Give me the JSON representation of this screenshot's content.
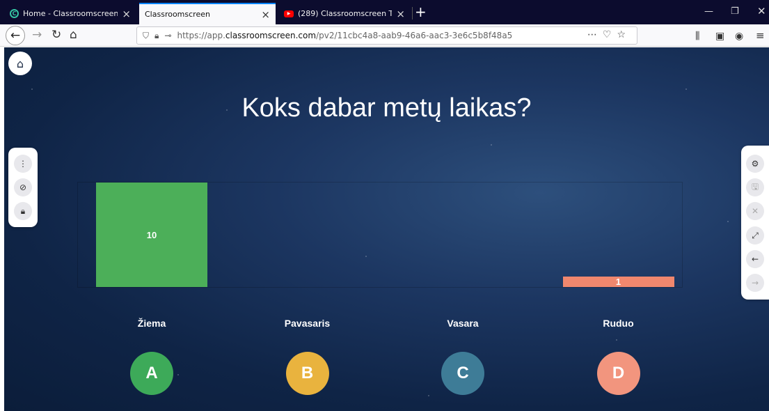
{
  "browser": {
    "tabs": [
      {
        "title": "Home - Classroomscreen",
        "active": false
      },
      {
        "title": "Classroomscreen",
        "active": true
      },
      {
        "title": "(289) Classroomscreen Tutorial",
        "active": false
      }
    ],
    "url": {
      "prefix": "https://app.",
      "domain": "classroomscreen.com",
      "path": "/pv2/11cbc4a8-aab9-46a6-aac3-3e6c5b8f48a5"
    }
  },
  "poll": {
    "question": "Koks dabar metų laikas?",
    "options": [
      {
        "letter": "A",
        "label": "Žiema",
        "votes": 10,
        "color": "#3daa59"
      },
      {
        "letter": "B",
        "label": "Pavasaris",
        "votes": 0,
        "color": "#e9b33e"
      },
      {
        "letter": "C",
        "label": "Vasara",
        "votes": 0,
        "color": "#3e7c97"
      },
      {
        "letter": "D",
        "label": "Ruduo",
        "votes": 1,
        "color": "#f2957e"
      }
    ]
  },
  "chart_data": {
    "type": "bar",
    "categories": [
      "Žiema",
      "Pavasaris",
      "Vasara",
      "Ruduo"
    ],
    "values": [
      10,
      0,
      0,
      1
    ],
    "title": "Koks dabar metų laikas?",
    "xlabel": "",
    "ylabel": "",
    "ylim": [
      0,
      10
    ],
    "bar_colors": [
      "#4caf59",
      "#e9b33e",
      "#3e7c97",
      "#f0876e"
    ]
  },
  "left_panel": [
    "more-vertical-icon",
    "eye-off-icon",
    "lock-icon"
  ],
  "right_panel": [
    "gear-icon",
    "save-icon",
    "pin-off-icon",
    "expand-icon",
    "arrow-left-icon",
    "arrow-right-icon"
  ]
}
